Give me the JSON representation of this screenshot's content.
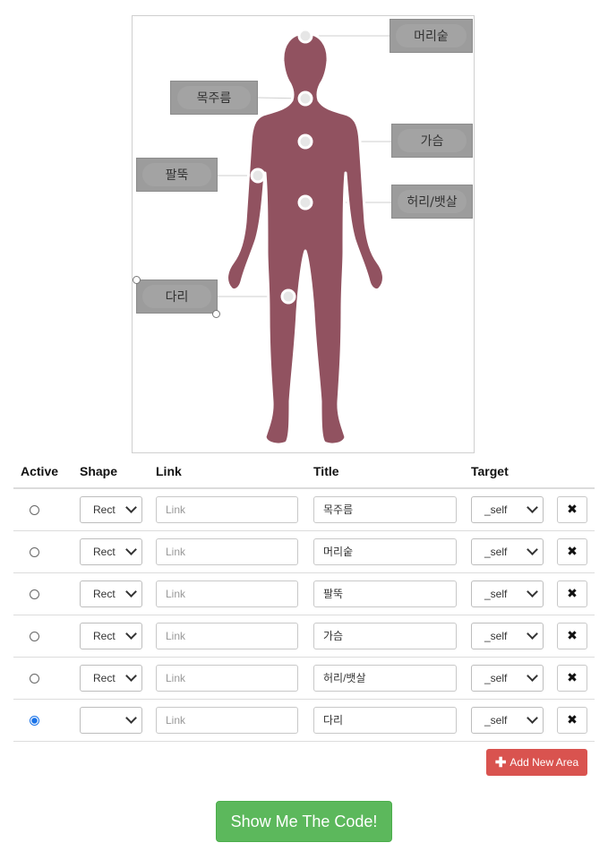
{
  "figure": {
    "labels": [
      {
        "id": "head",
        "text": "머리숱"
      },
      {
        "id": "neck",
        "text": "목주름"
      },
      {
        "id": "chest",
        "text": "가슴"
      },
      {
        "id": "arm",
        "text": "팔뚝"
      },
      {
        "id": "waist",
        "text": "허리/뱃살"
      },
      {
        "id": "leg",
        "text": "다리"
      }
    ],
    "colors": {
      "body": "#915260",
      "label_bg": "#9c9c9c"
    }
  },
  "table": {
    "headers": {
      "active": "Active",
      "shape": "Shape",
      "link": "Link",
      "title": "Title",
      "target": "Target"
    },
    "link_placeholder": "Link",
    "delete_icon": "✖",
    "rows": [
      {
        "active": false,
        "shape": "Rect",
        "title": "목주름",
        "target": "_self"
      },
      {
        "active": false,
        "shape": "Rect",
        "title": "머리숱",
        "target": "_self"
      },
      {
        "active": false,
        "shape": "Rect",
        "title": "팔뚝",
        "target": "_self"
      },
      {
        "active": false,
        "shape": "Rect",
        "title": "가슴",
        "target": "_self"
      },
      {
        "active": false,
        "shape": "Rect",
        "title": "허리/뱃살",
        "target": "_self"
      },
      {
        "active": true,
        "shape": "",
        "title": "다리",
        "target": "_self"
      }
    ]
  },
  "buttons": {
    "add_area": "Add New Area",
    "add_icon": "plus-icon",
    "show_code": "Show Me The Code!"
  },
  "colors": {
    "add_button": "#d9534f",
    "show_code_button": "#5cb85c",
    "radio_active": "#1a73e8"
  }
}
